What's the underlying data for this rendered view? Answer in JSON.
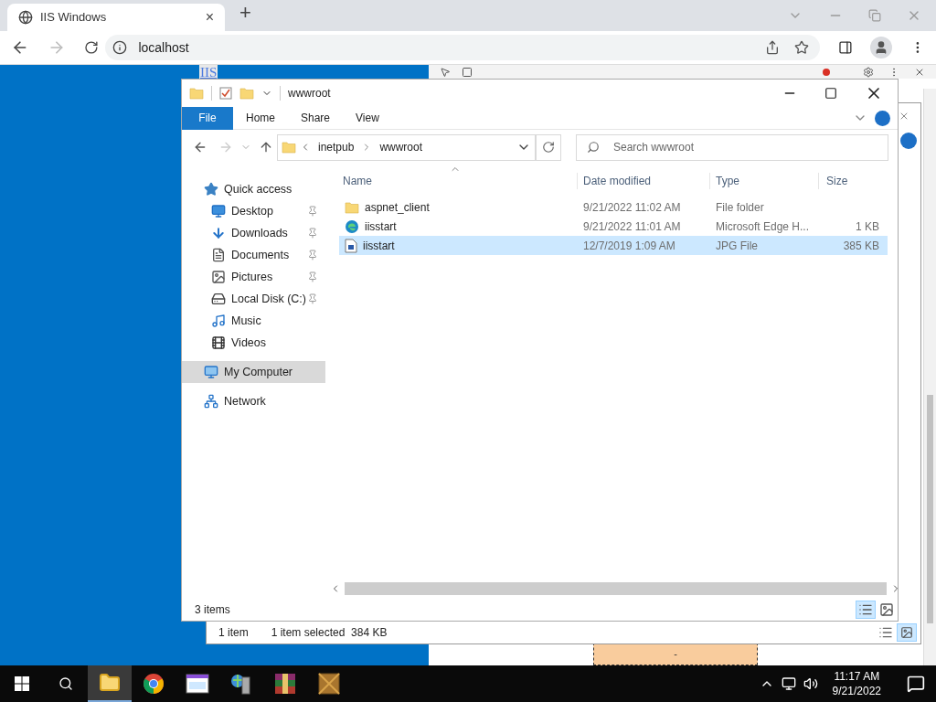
{
  "browser": {
    "tab_title": "IIS Windows",
    "tab_close": "×",
    "new_tab": "+",
    "url": "localhost",
    "forward_disabled": true
  },
  "page": {
    "image_alt": "IIS"
  },
  "devtools": {
    "box_text": "-"
  },
  "back_window": {
    "item_count": "1 item",
    "selection": "1 item selected  384 KB"
  },
  "explorer": {
    "title": "wwwroot",
    "ribbon_tabs": [
      {
        "label": "File",
        "selected": true
      },
      {
        "label": "Home",
        "selected": false
      },
      {
        "label": "Share",
        "selected": false
      },
      {
        "label": "View",
        "selected": false
      }
    ],
    "breadcrumb": [
      "inetpub",
      "wwwroot"
    ],
    "search_placeholder": "Search wwwroot",
    "nav": [
      {
        "label": "Quick access",
        "kind": "star",
        "selected": false,
        "children": [
          {
            "label": "Desktop",
            "kind": "desktop",
            "pinned": true,
            "selected": false
          },
          {
            "label": "Downloads",
            "kind": "download",
            "pinned": true,
            "selected": false
          },
          {
            "label": "Documents",
            "kind": "document",
            "pinned": true,
            "selected": false
          },
          {
            "label": "Pictures",
            "kind": "picture",
            "pinned": true,
            "selected": false
          },
          {
            "label": "Local Disk (C:)",
            "kind": "drive",
            "pinned": true,
            "selected": false
          },
          {
            "label": "Music",
            "kind": "music",
            "pinned": false,
            "selected": false
          },
          {
            "label": "Videos",
            "kind": "video",
            "pinned": false,
            "selected": false
          }
        ]
      },
      {
        "label": "My Computer",
        "kind": "computer",
        "selected": true
      },
      {
        "label": "Network",
        "kind": "network",
        "selected": false
      }
    ],
    "columns": [
      "Name",
      "Date modified",
      "Type",
      "Size"
    ],
    "files": [
      {
        "name": "aspnet_client",
        "date": "9/21/2022 11:02 AM",
        "type": "File folder",
        "kind": "folder",
        "selected": false
      },
      {
        "name": "iisstart",
        "date": "9/21/2022 11:01 AM",
        "type": "Microsoft Edge H...",
        "size": "1 KB",
        "kind": "web",
        "selected": false
      },
      {
        "name": "iisstart",
        "date": "12/7/2019 1:09 AM",
        "type": "JPG File",
        "size": "385 KB",
        "kind": "image",
        "selected": true
      }
    ],
    "status": "3 items"
  },
  "taskbar": {
    "apps": [
      {
        "kind": "explorer",
        "active": true
      },
      {
        "kind": "browser",
        "active": false
      },
      {
        "kind": "window",
        "active": false
      },
      {
        "kind": "server",
        "active": false
      },
      {
        "kind": "archive",
        "active": false
      },
      {
        "kind": "dosbox",
        "active": false
      }
    ],
    "time": "11:17 AM",
    "date": "9/21/2022"
  }
}
